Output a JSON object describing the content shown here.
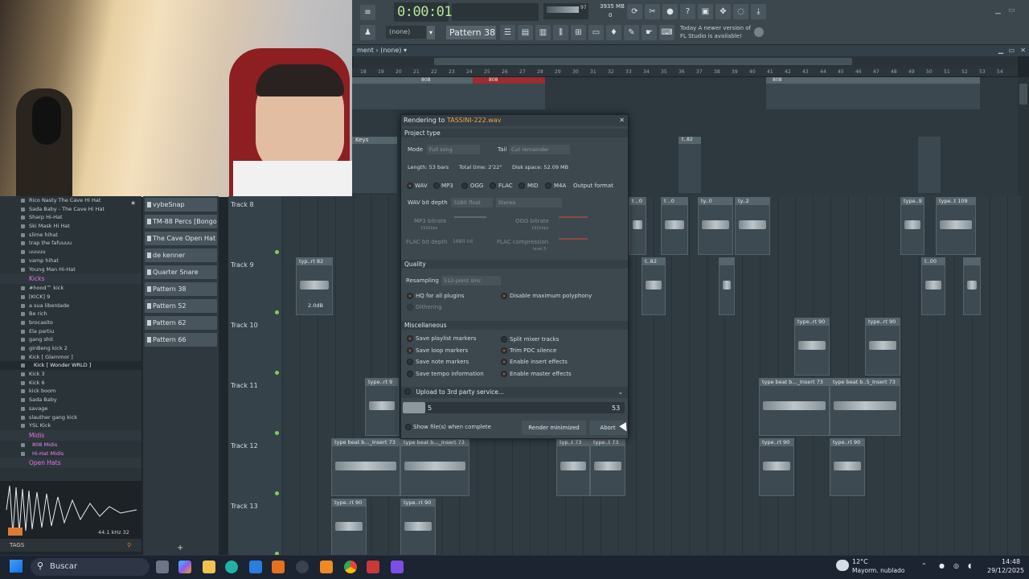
{
  "transport": {
    "time": "0:00:01",
    "memory": "3935 MB",
    "mem2": "0",
    "cpu": "97"
  },
  "toolbar": {
    "none1": "(none)",
    "pattern": "Pattern 38",
    "news_line1": "Today  A newer version of",
    "news_line2": "FL Studio is available!"
  },
  "playlist": {
    "title": "ment › (none) ▾",
    "ruler": [
      "18",
      "19",
      "20",
      "21",
      "22",
      "23",
      "24",
      "25",
      "26",
      "27",
      "28",
      "29",
      "30",
      "31",
      "32",
      "33",
      "34",
      "35",
      "36",
      "37",
      "38",
      "39",
      "40",
      "41",
      "42",
      "43",
      "44",
      "45",
      "46",
      "47",
      "48",
      "49",
      "50",
      "51",
      "52",
      "53",
      "54"
    ]
  },
  "top_clips": [
    {
      "label": "808"
    },
    {
      "label": "808"
    },
    {
      "label": "808"
    },
    {
      "label": "808"
    },
    {
      "label": "808"
    },
    {
      "label": "808"
    },
    {
      "label": "t..82"
    },
    {
      "label": "Keys"
    }
  ],
  "tracks": [
    {
      "name": "Track 8",
      "clips": [
        "t ..0",
        "ty..0",
        "ty..2",
        "type..9",
        "type..t 109"
      ]
    },
    {
      "name": "Track 9",
      "clips": [
        "typ..rt 82",
        "t..82",
        "t..00"
      ],
      "gain": "2.0dB"
    },
    {
      "name": "Track 10",
      "clips": [
        "type..rt 90",
        "type..rt 90"
      ]
    },
    {
      "name": "Track 11",
      "clips": [
        "type..rt 9",
        "type beat b..._Insert 73",
        "type beat b..5_Insert 73"
      ]
    },
    {
      "name": "Track 12",
      "clips": [
        "type beat b..._Insert 73",
        "type beat b..._Insert 73",
        "typ..t 73",
        "type..t 73",
        "type..rt 90",
        "type..rt 90"
      ]
    },
    {
      "name": "Track 13",
      "clips": [
        "type..rt 90",
        "type..rt 90"
      ]
    }
  ],
  "browser": {
    "items_a": [
      "Rico Nasty The Cave Hi Hat",
      "Sada Baby - The Cave Hi Hat",
      "Sharp Hi-Hat",
      "Ski Mask  Hi Hat",
      "slime hihat",
      "trap the fafuuuu",
      "uuuuu",
      "vamp hihat",
      "Young Man Hi-Hat"
    ],
    "folder_kicks": "Kicks",
    "items_b": [
      "#hood™ kick",
      "[KICK] 9",
      "a sua liberdade",
      "Be rich",
      "brocasito",
      "Ela partiu",
      "gang shit",
      "ginBeng kick 2",
      "Kick [ Glammor ]",
      "Kick [ Wonder WRLD ]",
      "Kick 3",
      "Kick 6",
      "kick boom",
      "Sada Baby",
      "savage",
      "slauther gang kick",
      "YSL Kick"
    ],
    "folder_midis": "Midis",
    "midi_items": [
      "808 Midis",
      "Hi-Hat Midis"
    ],
    "folder_open": "Open Hats",
    "sample_info": "44.1 kHz 32",
    "tags": "TAGS"
  },
  "channels": [
    "vybeSnap",
    "TM-88 Percs [Bongo 1]",
    "The Cave Open Hat",
    "de kenner",
    "Quarter Snare",
    "Pattern 38",
    "Pattern 52",
    "Pattern 62",
    "Pattern 66"
  ],
  "dialog": {
    "title_prefix": "Rendering to ",
    "filename": "TASSINI-222.wav",
    "sec_project": "Project type",
    "mode_label": "Mode",
    "mode_value": "Full song",
    "tail_label": "Tail",
    "tail_value": "Cut remainder",
    "length": "Length: 53 bars",
    "total": "Total time: 2'22\"",
    "disk": "Disk space: 52.09 MB",
    "formats": [
      "WAV",
      "MP3",
      "OGG",
      "FLAC",
      "MID",
      "M4A"
    ],
    "output_format": "Output format",
    "bitdepth_label": "WAV bit depth",
    "bitdepth_value": "32Bit float",
    "stereo": "Stereo",
    "mp3": "MP3 bitrate",
    "mp3v": "192kbps",
    "ogg": "OGG bitrate",
    "oggv": "192kbps",
    "flac": "FLAC bit depth",
    "flacv": "16Bit int",
    "flaccomp": "FLAC compression",
    "flaccompv": "level 5",
    "sec_quality": "Quality",
    "resampling": "Resampling",
    "resampling_value": "512-point sinc",
    "hq": "HQ for all plugins",
    "polyphony": "Disable maximum polyphony",
    "dithering": "Dithering",
    "sec_misc": "Miscellaneous",
    "misc_left": [
      "Save playlist markers",
      "Save loop markers",
      "Save note markers",
      "Save tempo information"
    ],
    "misc_right": [
      "Split mixer tracks",
      "Trim PDC silence",
      "Enable insert effects",
      "Enable master effects"
    ],
    "upload": "Upload to 3rd party service...",
    "progress_current": "5",
    "progress_total": "53",
    "progress_fraction": 0.094,
    "show_files": "Show file(s) when complete",
    "render_min": "Render minimized",
    "abort": "Abort"
  },
  "taskbar": {
    "search": "Buscar",
    "temp": "12°C",
    "weather": "Mayorm. nublado",
    "time": "14:48",
    "date": "29/12/2025"
  }
}
